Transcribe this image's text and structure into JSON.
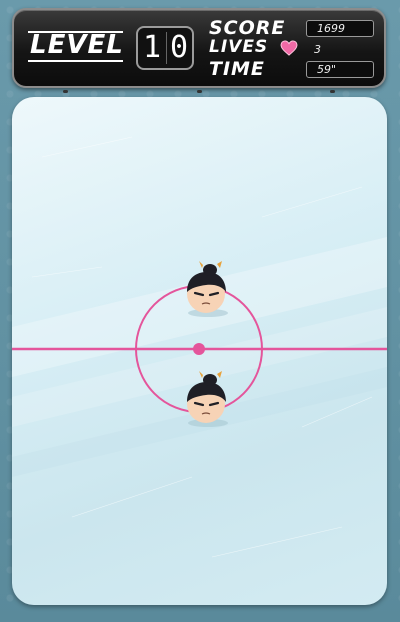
{
  "hud": {
    "level_label": "LEVEL",
    "level_digits": [
      "1",
      "0"
    ],
    "score_label": "SCORE",
    "score_value": "1699",
    "lives_label": "LIVES",
    "lives_value": "3",
    "time_label": "TIME",
    "time_value": "59\""
  },
  "colors": {
    "hud_background": "#151515",
    "rink_line": "#e4559b",
    "heart": "#f06aa6",
    "background": "#5e8fa0"
  },
  "players": [
    {
      "role": "opponent",
      "icon": "samurai-head-icon"
    },
    {
      "role": "player",
      "icon": "samurai-head-icon"
    }
  ]
}
